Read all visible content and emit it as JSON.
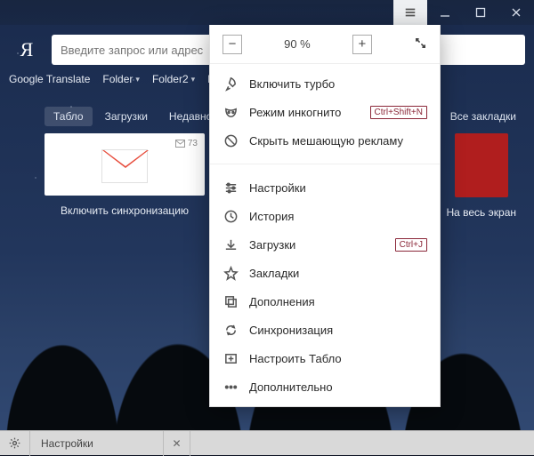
{
  "search": {
    "placeholder": "Введите запрос или адрес"
  },
  "zoom": {
    "minus": "−",
    "value": "90 %",
    "plus": "+"
  },
  "bookmarks": {
    "i0": "Google Translate",
    "i1": "Folder",
    "i2": "Folder2",
    "i3": "Read"
  },
  "tabs": {
    "t0": "Табло",
    "t1": "Загрузки",
    "t2": "Недавно",
    "right": "Все закладки"
  },
  "tiles": {
    "gmail_badge": "73",
    "gmail_label": "Включить синхронизацию",
    "red_label": "На весь экран"
  },
  "menu": {
    "turbo": "Включить турбо",
    "incognito": "Режим инкогнито",
    "incognito_shortcut": "Ctrl+Shift+N",
    "hide_ads": "Скрыть мешающую рекламу",
    "settings": "Настройки",
    "history": "История",
    "downloads": "Загрузки",
    "downloads_shortcut": "Ctrl+J",
    "bookmarks": "Закладки",
    "addons": "Дополнения",
    "sync": "Синхронизация",
    "tablo": "Настроить Табло",
    "more": "Дополнительно"
  },
  "taskbar": {
    "tab1": "Настройки"
  }
}
